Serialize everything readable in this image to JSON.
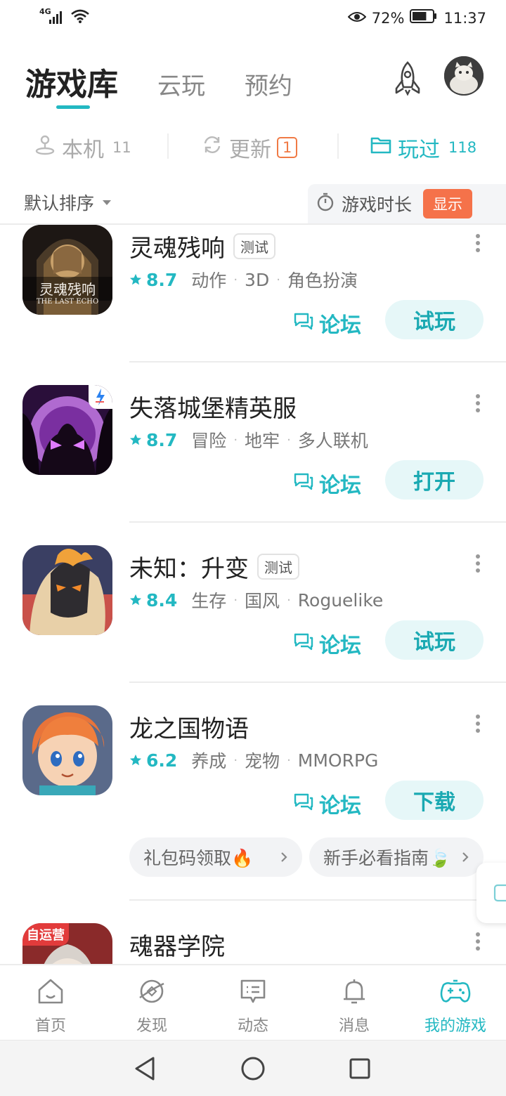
{
  "status_bar": {
    "network": "4G",
    "battery_percent": "72%",
    "time": "11:37",
    "battery_level": 0.72
  },
  "header": {
    "tabs": [
      {
        "label": "游戏库",
        "active": true
      },
      {
        "label": "云玩",
        "active": false
      },
      {
        "label": "预约",
        "active": false
      }
    ]
  },
  "filters": {
    "local": {
      "label": "本机",
      "count": "11"
    },
    "update": {
      "label": "更新",
      "count": "1"
    },
    "played": {
      "label": "玩过",
      "count": "118",
      "active": true
    }
  },
  "sort": {
    "label": "默认排序",
    "playtime_label": "游戏时长",
    "show_label": "显示"
  },
  "games": [
    {
      "title": "灵魂残响",
      "tag": "测试",
      "rating": "8.7",
      "genres": [
        "动作",
        "3D",
        "角色扮演"
      ],
      "forum_label": "论坛",
      "action_label": "试玩",
      "icon_text": "灵魂残响",
      "icon_subtext": "THE LAST ECHO"
    },
    {
      "title": "失落城堡精英服",
      "tag": "",
      "rating": "8.7",
      "genres": [
        "冒险",
        "地牢",
        "多人联机"
      ],
      "forum_label": "论坛",
      "action_label": "打开"
    },
    {
      "title": "未知：升变",
      "tag": "测试",
      "rating": "8.4",
      "genres": [
        "生存",
        "国风",
        "Roguelike"
      ],
      "forum_label": "论坛",
      "action_label": "试玩"
    },
    {
      "title": "龙之国物语",
      "tag": "",
      "rating": "6.2",
      "genres": [
        "养成",
        "宠物",
        "MMORPG"
      ],
      "forum_label": "论坛",
      "action_label": "下载",
      "chips": [
        "礼包码领取🔥",
        "新手必看指南🍃"
      ]
    },
    {
      "title": "魂器学院",
      "tag": "",
      "icon_badge": "自运营"
    }
  ],
  "bottom_nav": [
    {
      "label": "首页",
      "icon": "home-icon"
    },
    {
      "label": "发现",
      "icon": "discover-icon"
    },
    {
      "label": "动态",
      "icon": "feed-icon"
    },
    {
      "label": "消息",
      "icon": "bell-icon"
    },
    {
      "label": "我的游戏",
      "icon": "gamepad-icon",
      "active": true
    }
  ],
  "colors": {
    "accent": "#23b8c2",
    "orange": "#f5724a",
    "text": "#222222",
    "muted": "#888888"
  }
}
